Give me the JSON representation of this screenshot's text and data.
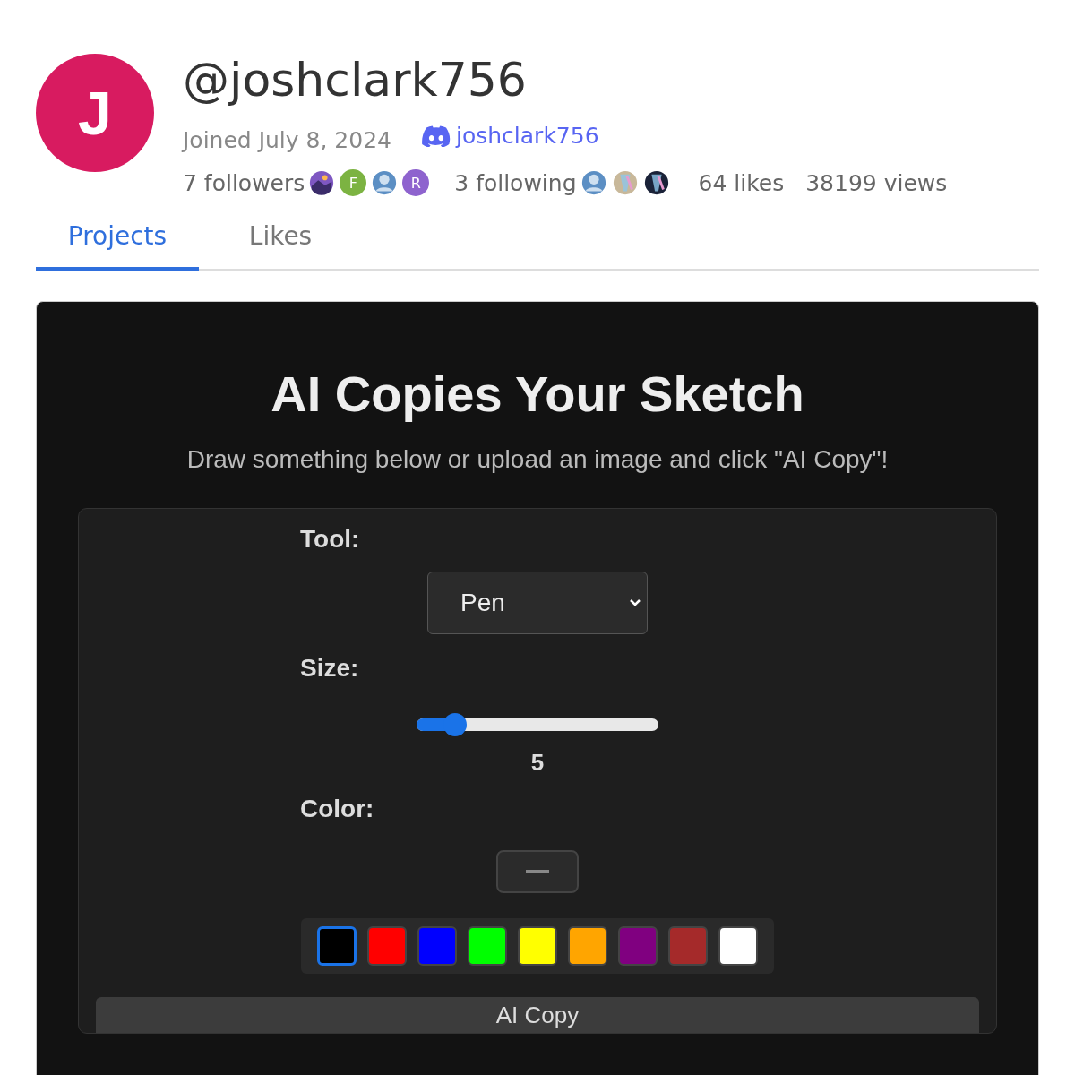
{
  "profile": {
    "avatar_letter": "J",
    "handle": "@joshclark756",
    "joined": "Joined July 8, 2024",
    "discord": "joshclark756",
    "followers": "7 followers",
    "follower_avatars": [
      {
        "kind": "picture",
        "color": "#7e57c2"
      },
      {
        "kind": "letter",
        "letter": "F",
        "color": "#7cb342"
      },
      {
        "kind": "user",
        "color": "#5c8fc4"
      },
      {
        "kind": "letter",
        "letter": "R",
        "color": "#8e63ce"
      }
    ],
    "following": "3 following",
    "following_avatars": [
      {
        "kind": "user",
        "color": "#5c8fc4"
      },
      {
        "kind": "picture",
        "color": "#c8b89a"
      },
      {
        "kind": "picture",
        "color": "#1a2238"
      }
    ],
    "likes": "64 likes",
    "views": "38199 views"
  },
  "tabs": [
    {
      "label": "Projects",
      "selected": true
    },
    {
      "label": "Likes",
      "selected": false
    }
  ],
  "app": {
    "title": "AI Copies Your Sketch",
    "subtitle": "Draw something below or upload an image and click \"AI Copy\"!",
    "tool_label": "Tool:",
    "tool_value": "Pen",
    "size_label": "Size:",
    "size_slider": {
      "level": 0.16
    },
    "size_value": "5",
    "color_label": "Color:",
    "swatches": [
      {
        "color": "#000000",
        "selected": true
      },
      {
        "color": "#ff0000",
        "selected": false
      },
      {
        "color": "#0000ff",
        "selected": false
      },
      {
        "color": "#00ff00",
        "selected": false
      },
      {
        "color": "#ffff00",
        "selected": false
      },
      {
        "color": "#ffa500",
        "selected": false
      },
      {
        "color": "#800080",
        "selected": false
      },
      {
        "color": "#a52a2a",
        "selected": false
      },
      {
        "color": "#ffffff",
        "selected": false
      }
    ],
    "button": "AI Copy"
  }
}
